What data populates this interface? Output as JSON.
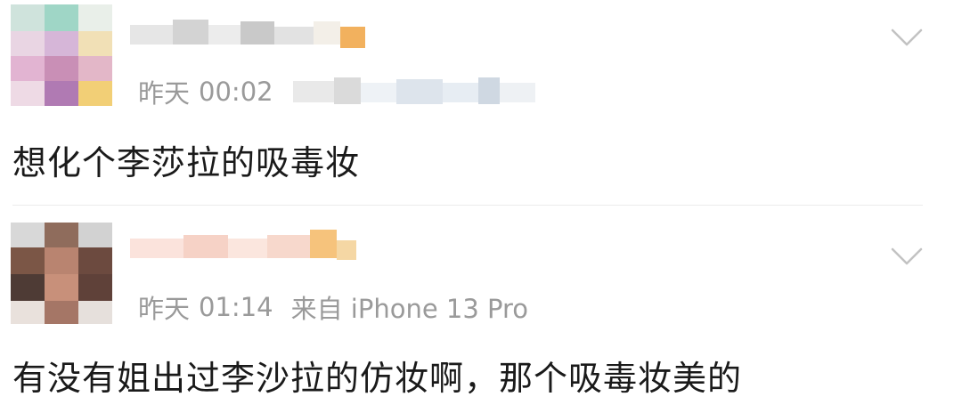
{
  "posts": [
    {
      "date": "昨天",
      "time": "00:02",
      "source": "",
      "content": "想化个李莎拉的吸毒妆"
    },
    {
      "date": "昨天",
      "time": "01:14",
      "source": "来自 iPhone 13 Pro",
      "content": "有没有姐出过李沙拉的仿妆啊，那个吸毒妆美的"
    }
  ],
  "icons": {
    "expand": "chevron-down-icon"
  },
  "colors": {
    "meta_text": "#9a9a9a",
    "content_text": "#1a1a1a",
    "chevron": "#c2c2c2",
    "divider": "#ececec"
  }
}
